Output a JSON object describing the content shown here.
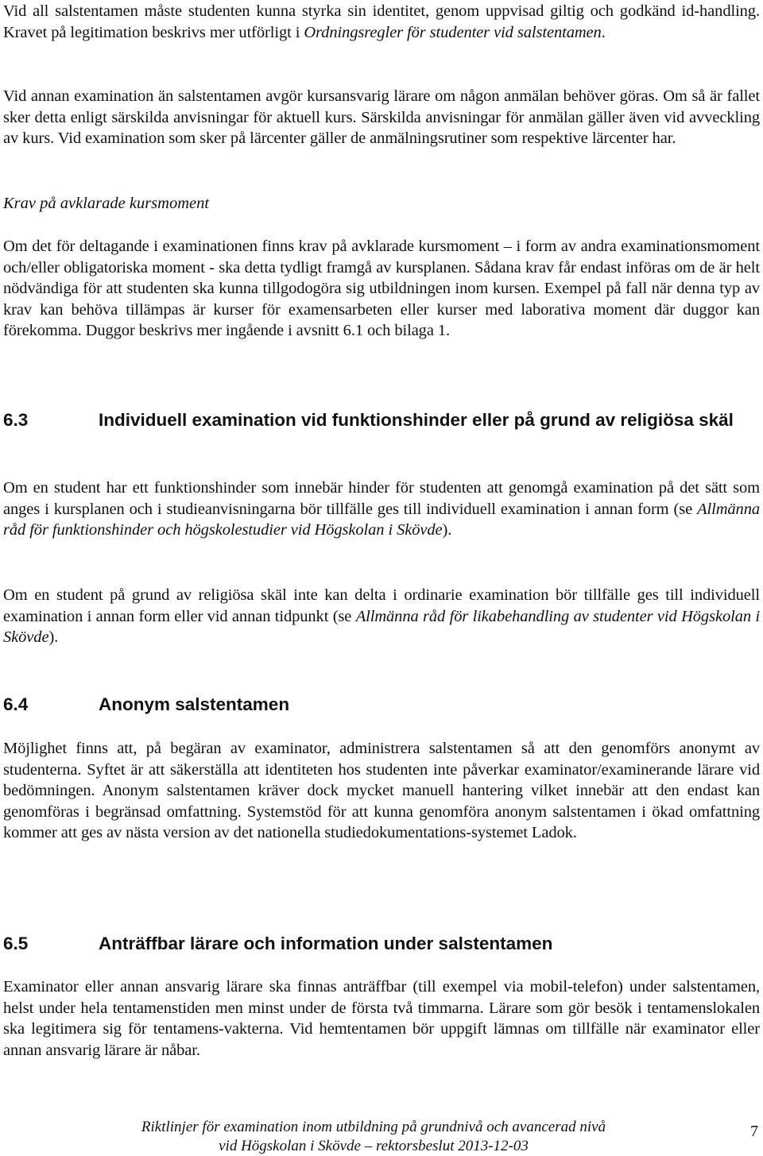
{
  "document": {
    "intro": {
      "p1_a": "Vid all salstentamen måste studenten kunna styrka sin identitet, genom uppvisad giltig och godkänd id-handling. Kravet på legitimation beskrivs mer utförligt i ",
      "p1_italic": "Ordningsregler för studenter vid salstentamen",
      "p1_b": ".",
      "p2": "Vid annan examination än salstentamen avgör kursansvarig lärare om någon anmälan behöver göras. Om så är fallet sker detta enligt särskilda anvisningar för aktuell kurs. Särskilda anvisningar för anmälan gäller även vid avveckling av kurs. Vid examination som sker på lärcenter gäller de anmälningsrutiner som respektive lärcenter har."
    },
    "krav": {
      "subheading": "Krav på avklarade kursmoment",
      "paragraph": "Om det för deltagande i examinationen finns krav på avklarade kursmoment – i form av andra examinationsmoment och/eller obligatoriska moment - ska detta tydligt framgå av kursplanen. Sådana krav får endast införas om de är helt nödvändiga för att studenten ska kunna tillgodogöra sig utbildningen inom kursen. Exempel på fall när denna typ av krav kan behöva tillämpas är kurser för examensarbeten eller kurser med laborativa moment där duggor kan förekomma. Duggor beskrivs mer ingående i avsnitt 6.1 och bilaga 1."
    },
    "sections": [
      {
        "number": "6.3",
        "title": "Individuell examination vid funktionshinder eller på grund av religiösa skäl",
        "p1_a": "Om en student har ett funktionshinder som innebär hinder för studenten att genomgå examination på det sätt som anges i kursplanen och i studieanvisningarna bör tillfälle ges till individuell examination i annan form (se ",
        "p1_italic": "Allmänna råd för funktionshinder och högskolestudier vid Högskolan i Skövde",
        "p1_b": ").",
        "p2_a": "Om en student på grund av religiösa skäl inte kan delta i ordinarie examination bör tillfälle ges till individuell examination i annan form eller vid annan tidpunkt (se ",
        "p2_italic": "Allmänna råd för likabehandling av studenter vid Högskolan i Skövde",
        "p2_b": ")."
      },
      {
        "number": "6.4",
        "title": "Anonym salstentamen",
        "p1": "Möjlighet finns att, på begäran av examinator, administrera salstentamen så att den genomförs anonymt av studenterna. Syftet är att säkerställa att identiteten hos studenten inte påverkar examinator/examinerande lärare vid bedömningen. Anonym salstentamen kräver dock mycket manuell hantering vilket innebär att den endast kan genomföras i begränsad omfattning. Systemstöd för att kunna genomföra anonym salstentamen i ökad omfattning kommer att ges av nästa version av det nationella studiedokumentations-systemet Ladok."
      },
      {
        "number": "6.5",
        "title": "Anträffbar lärare och information under salstentamen",
        "p1": "Examinator eller annan ansvarig lärare ska finnas anträffbar (till exempel via mobil-telefon) under salstentamen, helst under hela tentamenstiden men minst under de första två timmarna. Lärare som gör besök i tentamenslokalen ska legitimera sig för tentamens-vakterna. Vid hemtentamen bör uppgift lämnas om tillfälle när examinator eller annan ansvarig lärare är nåbar."
      }
    ],
    "footer": {
      "line1": "Riktlinjer för examination inom utbildning på grundnivå och avancerad nivå",
      "line2": "vid Högskolan i Skövde – rektorsbeslut 2013-12-03",
      "page_number": "7"
    }
  }
}
